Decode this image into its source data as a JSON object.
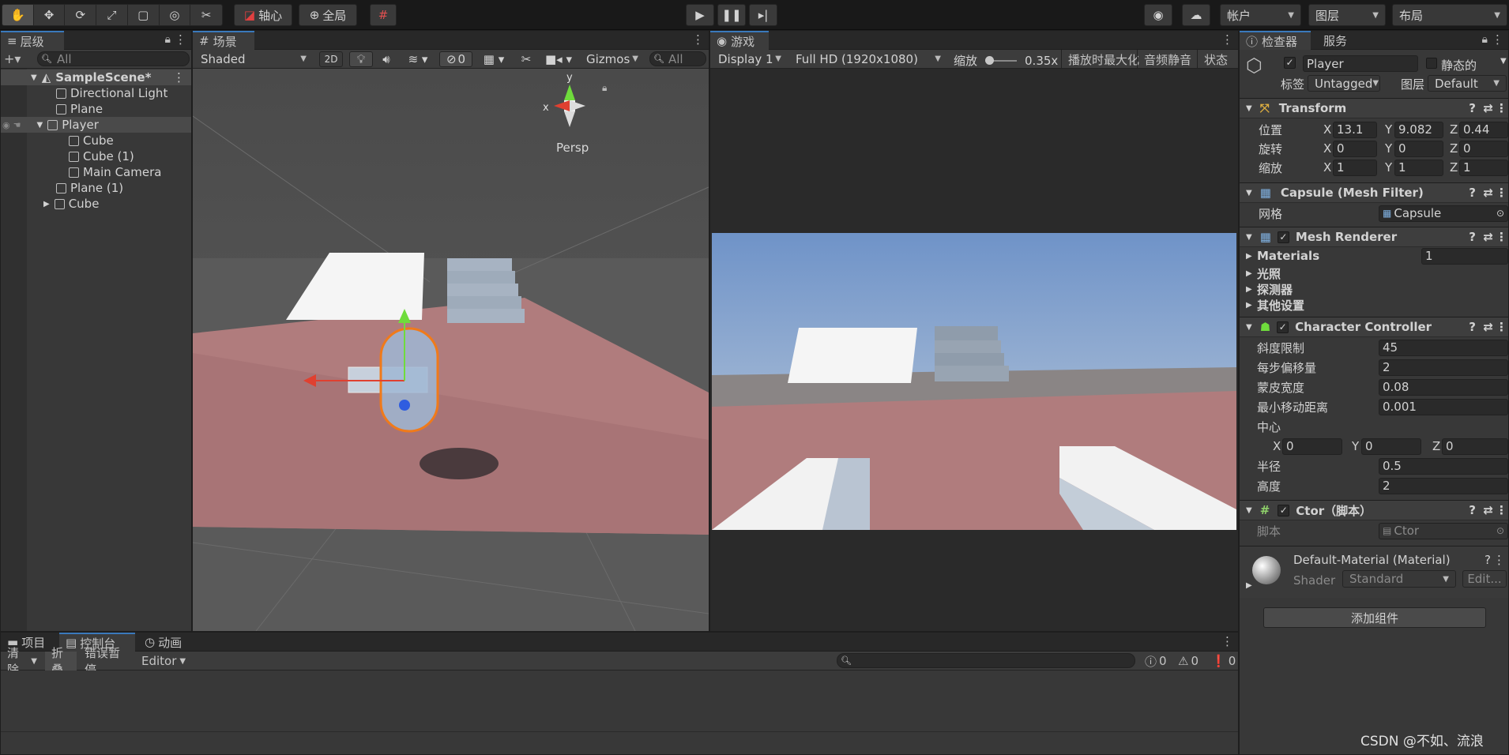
{
  "toolbar": {
    "tools": [
      "hand-tool",
      "move-tool",
      "rotate-tool",
      "scale-tool",
      "rect-tool",
      "transform-tool",
      "custom-tool"
    ],
    "pivot_label": "轴心",
    "global_label": "全局",
    "account_label": "帐户",
    "layers_label": "图层",
    "layout_label": "布局"
  },
  "hierarchy": {
    "tab_label": "层级",
    "search_placeholder": "All",
    "scene_name": "SampleScene*",
    "items": [
      {
        "label": "Directional Light",
        "depth": 1
      },
      {
        "label": "Plane",
        "depth": 1
      },
      {
        "label": "Player",
        "depth": 1
      },
      {
        "label": "Cube",
        "depth": 2
      },
      {
        "label": "Cube (1)",
        "depth": 2
      },
      {
        "label": "Main Camera",
        "depth": 2
      },
      {
        "label": "Plane (1)",
        "depth": 1
      },
      {
        "label": "Cube",
        "depth": 1
      }
    ]
  },
  "scene": {
    "tab_label": "场景",
    "shading_mode": "Shaded",
    "mode_2d": "2D",
    "hidden_count": "0",
    "gizmos_label": "Gizmos",
    "search_placeholder": "All",
    "projection_label": "Persp",
    "axis_x": "x",
    "axis_y": "y"
  },
  "game": {
    "tab_label": "游戏",
    "display": "Display 1",
    "resolution": "Full HD (1920x1080)",
    "scale_label": "缩放",
    "scale_value": "0.35x",
    "maximize_label": "播放时最大化",
    "mute_label": "音频静音",
    "stats_label": "状态"
  },
  "inspector": {
    "tab_label": "检查器",
    "services_tab": "服务",
    "object_name": "Player",
    "static_label": "静态的",
    "tag_label": "标签",
    "tag_value": "Untagged",
    "layer_label": "图层",
    "layer_value": "Default",
    "transform": {
      "title": "Transform",
      "position_label": "位置",
      "position": [
        "13.1",
        "9.082",
        "0.44"
      ],
      "rotation_label": "旋转",
      "rotation": [
        "0",
        "0",
        "0"
      ],
      "scale_label": "缩放",
      "scale": [
        "1",
        "1",
        "1"
      ]
    },
    "mesh_filter": {
      "title": "Capsule (Mesh Filter)",
      "mesh_label": "网格",
      "mesh_value": "Capsule"
    },
    "mesh_renderer": {
      "title": "Mesh Renderer",
      "materials_label": "Materials",
      "materials_count": "1",
      "lighting_label": "光照",
      "probes_label": "探测器",
      "other_label": "其他设置"
    },
    "character_controller": {
      "title": "Character Controller",
      "slope_label": "斜度限制",
      "slope": "45",
      "step_label": "每步偏移量",
      "step": "2",
      "skin_label": "蒙皮宽度",
      "skin": "0.08",
      "min_move_label": "最小移动距离",
      "min_move": "0.001",
      "center_label": "中心",
      "center": [
        "0",
        "0",
        "0"
      ],
      "radius_label": "半径",
      "radius": "0.5",
      "height_label": "高度",
      "height": "2"
    },
    "script": {
      "title": "Ctor（脚本）",
      "script_label": "脚本",
      "script_value": "Ctor"
    },
    "material": {
      "title": "Default-Material (Material)",
      "shader_label": "Shader",
      "shader_value": "Standard",
      "edit_label": "Edit..."
    },
    "add_component": "添加组件"
  },
  "bottom": {
    "tabs": [
      "项目",
      "控制台",
      "动画"
    ],
    "clear_label": "清除",
    "collapse_label": "折叠",
    "error_pause_label": "错误暂停",
    "editor_label": "Editor",
    "log_count": "0",
    "warn_count": "0",
    "error_count": "0"
  },
  "watermark": "CSDN @不如、流浪"
}
